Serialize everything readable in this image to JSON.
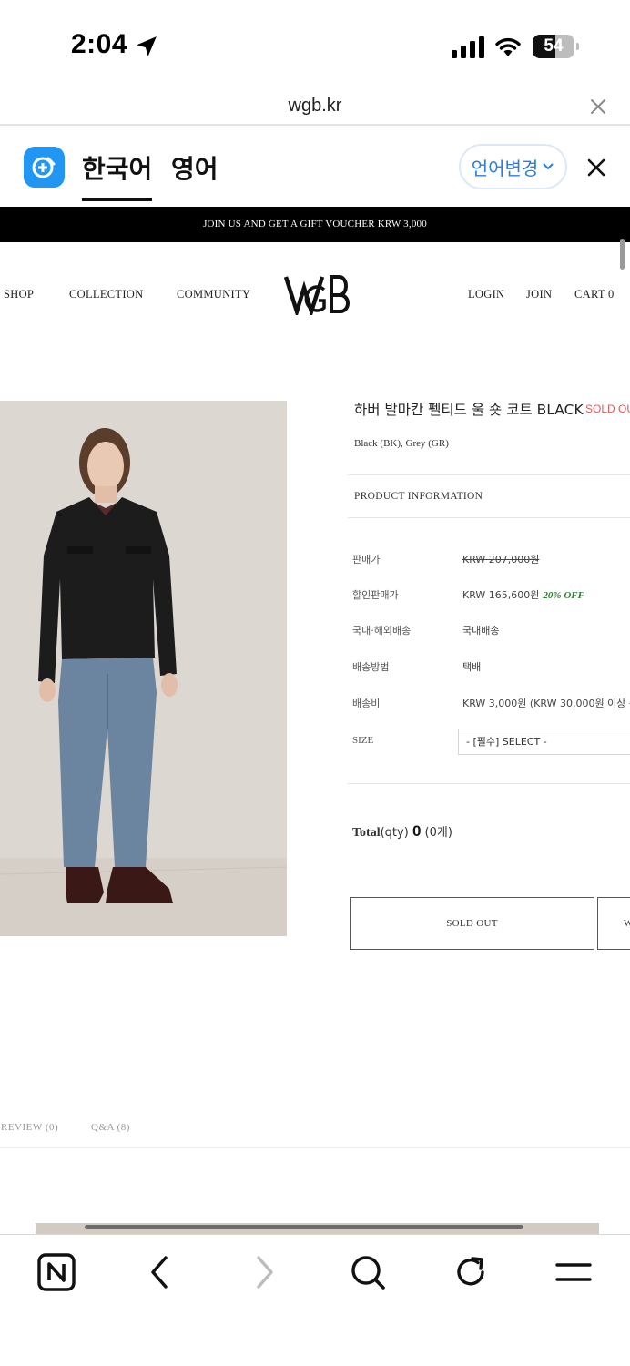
{
  "status_bar": {
    "time": "2:04",
    "battery": "54",
    "battery_level": 0.54
  },
  "url_bar": {
    "url": "wgb.kr"
  },
  "translate_bar": {
    "tabs": [
      {
        "label": "한국어",
        "active": true
      },
      {
        "label": "영어",
        "active": false
      }
    ],
    "change_language_label": "언어변경"
  },
  "promo": {
    "text": "JOIN US AND GET A GIFT VOUCHER KRW 3,000"
  },
  "nav": {
    "left": [
      "SHOP",
      "COLLECTION",
      "COMMUNITY"
    ],
    "logo_text": "WGB",
    "right": [
      "LOGIN",
      "JOIN",
      "CART 0"
    ]
  },
  "product": {
    "name": "하버 발마칸 펠티드 울 숏 코트 BLACK",
    "status_tag": "SOLD OUT",
    "colors": "Black (BK), Grey (GR)",
    "info_heading": "PRODUCT INFORMATION",
    "rows": [
      {
        "label": "판매가",
        "value": "KRW 207,000원"
      },
      {
        "label": "할인판매가",
        "value": "KRW 165,600원",
        "badge": "20% OFF"
      },
      {
        "label": "국내·해외배송",
        "value": "국내배송"
      },
      {
        "label": "배송방법",
        "value": "택배"
      },
      {
        "label": "배송비",
        "value": "KRW 3,000원 (KRW 30,000원 이상 구매"
      }
    ],
    "size": {
      "label": "SIZE",
      "selected": "- [필수] SELECT -"
    },
    "total": {
      "label": "Total",
      "unit": "(qty)",
      "qty": "0",
      "count": "(0개)"
    },
    "buttons": {
      "sold_out": "SOLD OUT",
      "wish": "W"
    }
  },
  "tabs": [
    "REVIEW (0)",
    "Q&A (8)"
  ],
  "colors": {
    "promo_bg": "#000000",
    "sold_tag": "#e05a5a",
    "discount": "#2e7d32",
    "link_blue": "#2b7de0",
    "translate_icon": "#2196f3"
  },
  "toolbar_icons": [
    "naver-n-icon",
    "back-icon",
    "forward-icon",
    "search-icon",
    "refresh-icon",
    "menu-icon"
  ]
}
